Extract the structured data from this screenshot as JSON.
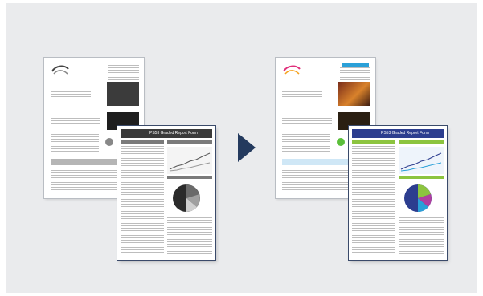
{
  "illustration": {
    "arrow_icon": "right-triangle-arrow",
    "before": {
      "report_title": "PS53 Graded Report Form",
      "palette": {
        "header": "#3a3a3a",
        "section": "#7a7a7a",
        "accent": "#2b2b2b"
      }
    },
    "after": {
      "report_title": "PS53 Graded Report Form",
      "palette": {
        "header": "#2c3d8f",
        "section": "#8cc43f",
        "accent": "#2aa0d8",
        "highlight": "#d6eaf7"
      }
    }
  }
}
